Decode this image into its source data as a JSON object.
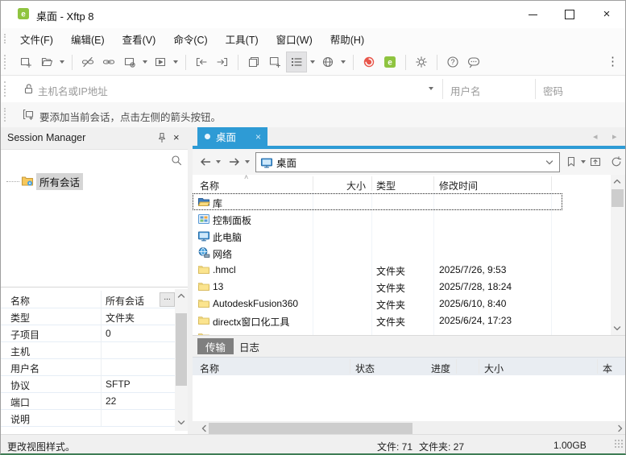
{
  "window": {
    "title": "桌面 - Xftp 8"
  },
  "menu": {
    "items": [
      "文件(F)",
      "编辑(E)",
      "查看(V)",
      "命令(C)",
      "工具(T)",
      "窗口(W)",
      "帮助(H)"
    ]
  },
  "connect_bar": {
    "host_placeholder": "主机名或IP地址",
    "username_placeholder": "用户名",
    "password_placeholder": "密码"
  },
  "info_bar": {
    "message": "要添加当前会话，点击左侧的箭头按钮。"
  },
  "session_manager": {
    "title": "Session Manager",
    "root_label": "所有会话",
    "more_button": "...",
    "properties": [
      {
        "label": "名称",
        "value": "所有会话"
      },
      {
        "label": "类型",
        "value": "文件夹"
      },
      {
        "label": "子项目",
        "value": "0"
      },
      {
        "label": "主机",
        "value": ""
      },
      {
        "label": "用户名",
        "value": ""
      },
      {
        "label": "协议",
        "value": "SFTP"
      },
      {
        "label": "端口",
        "value": "22"
      },
      {
        "label": "说明",
        "value": ""
      }
    ]
  },
  "session_tabs": {
    "active_label": "桌面"
  },
  "navigation": {
    "address": "桌面"
  },
  "file_browser": {
    "columns": {
      "name": "名称",
      "size": "大小",
      "type": "类型",
      "modified": "修改时间"
    },
    "rows": [
      {
        "icon": "library",
        "name": "库",
        "size": "",
        "type": "",
        "date": ""
      },
      {
        "icon": "control-panel",
        "name": "控制面板",
        "size": "",
        "type": "",
        "date": ""
      },
      {
        "icon": "computer",
        "name": "此电脑",
        "size": "",
        "type": "",
        "date": ""
      },
      {
        "icon": "network",
        "name": "网络",
        "size": "",
        "type": "",
        "date": ""
      },
      {
        "icon": "folder",
        "name": ".hmcl",
        "size": "",
        "type": "文件夹",
        "date": "2025/7/26, 9:53"
      },
      {
        "icon": "folder",
        "name": "13",
        "size": "",
        "type": "文件夹",
        "date": "2025/7/28, 18:24"
      },
      {
        "icon": "folder",
        "name": "AutodeskFusion360",
        "size": "",
        "type": "文件夹",
        "date": "2025/6/10, 8:40"
      },
      {
        "icon": "folder",
        "name": "directx窗口化工具",
        "size": "",
        "type": "文件夹",
        "date": "2025/6/24, 17:23"
      }
    ]
  },
  "transfer_panel": {
    "tabs": {
      "transfer": "传输",
      "log": "日志"
    },
    "columns": {
      "name": "名称",
      "status": "状态",
      "progress": "进度",
      "size": "大小",
      "local": "本"
    }
  },
  "status_bar": {
    "hint": "更改视图样式。",
    "file_count": "文件: 71",
    "folder_count": "文件夹: 27",
    "total_size": "1.00GB"
  },
  "colors": {
    "tab_active_blue": "#2E9BD5",
    "xftp_green": "#8FC440",
    "xshell_red": "#E8564B",
    "transfer_tab_gray": "#7F7F7F"
  }
}
